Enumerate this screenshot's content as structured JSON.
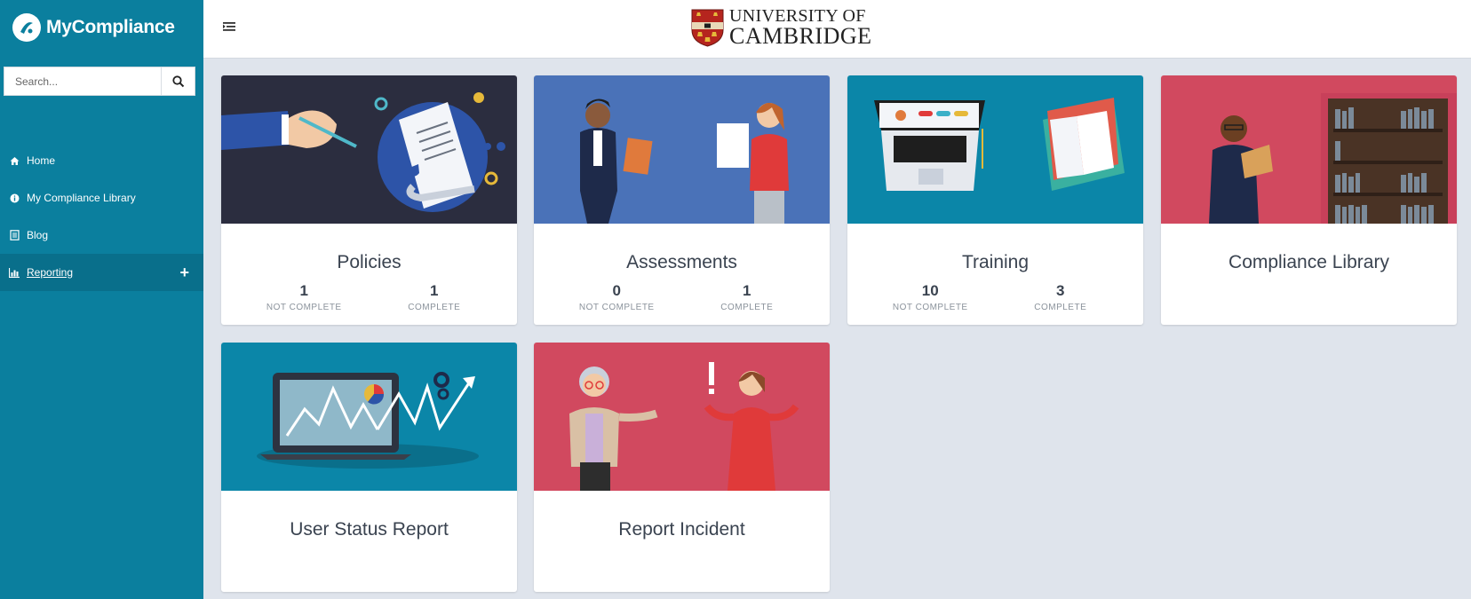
{
  "app": {
    "name": "MyCompliance"
  },
  "search": {
    "placeholder": "Search..."
  },
  "nav": {
    "items": [
      {
        "label": "Home",
        "icon": "home-icon"
      },
      {
        "label": "My Compliance Library",
        "icon": "info-icon"
      },
      {
        "label": "Blog",
        "icon": "document-icon"
      },
      {
        "label": "Reporting",
        "icon": "bar-chart-icon",
        "active": true
      }
    ]
  },
  "header": {
    "org_line1": "UNIVERSITY OF",
    "org_line2": "CAMBRIDGE"
  },
  "cards": [
    {
      "title": "Policies",
      "stats": [
        {
          "value": "1",
          "label": "NOT COMPLETE"
        },
        {
          "value": "1",
          "label": "COMPLETE"
        }
      ]
    },
    {
      "title": "Assessments",
      "stats": [
        {
          "value": "0",
          "label": "NOT COMPLETE"
        },
        {
          "value": "1",
          "label": "COMPLETE"
        }
      ]
    },
    {
      "title": "Training",
      "stats": [
        {
          "value": "10",
          "label": "NOT COMPLETE"
        },
        {
          "value": "3",
          "label": "COMPLETE"
        }
      ]
    },
    {
      "title": "Compliance Library"
    },
    {
      "title": "User Status Report"
    },
    {
      "title": "Report Incident"
    }
  ],
  "colors": {
    "sidebar": "#0b7f9e",
    "policies_bg": "#2b2d3f",
    "assessments_bg": "#4a72b8",
    "training_bg": "#0b86a8",
    "library_bg": "#d1495f",
    "report_bg": "#0b86a8",
    "incident_bg": "#d1495f"
  }
}
